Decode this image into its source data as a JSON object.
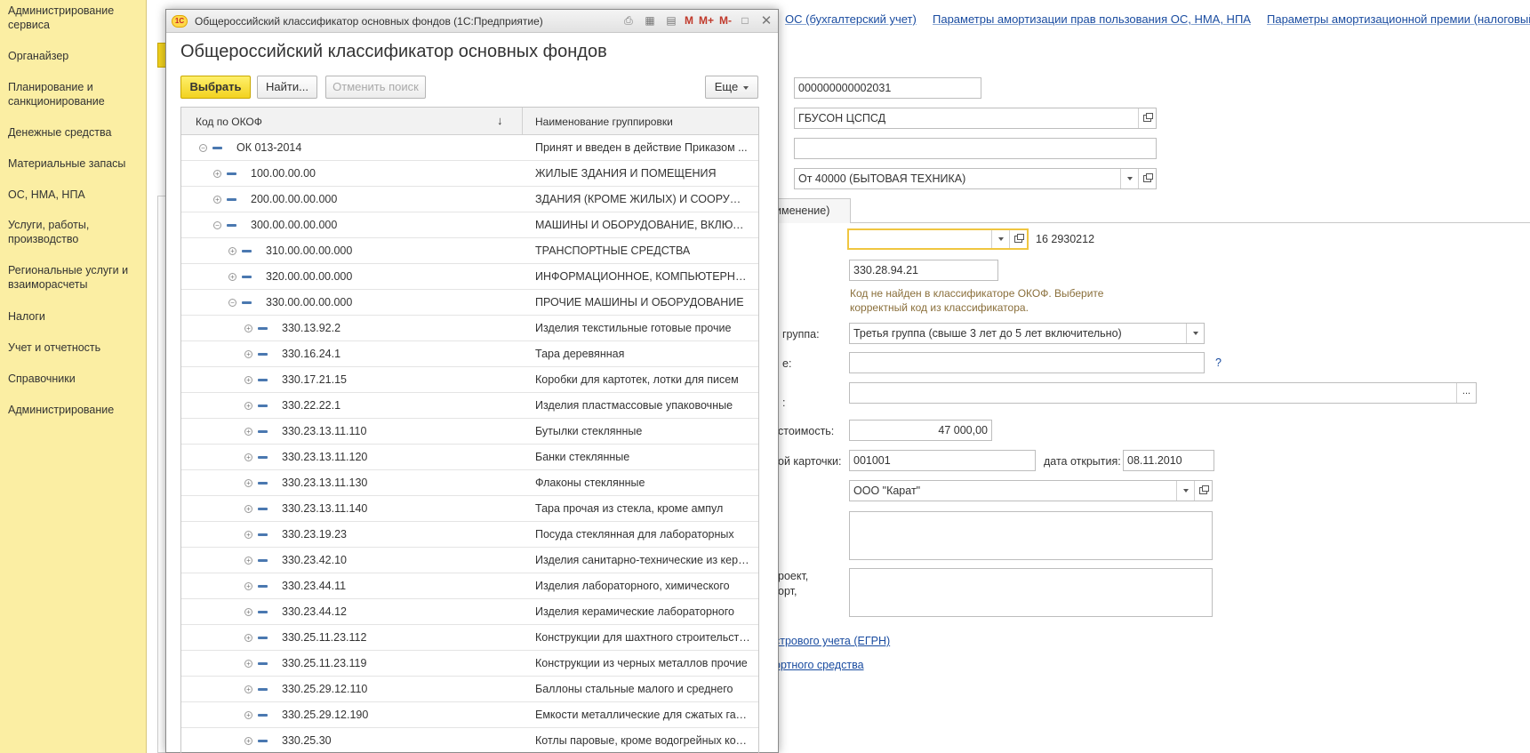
{
  "sidebar": {
    "items": [
      "Администрирование сервиса",
      "Органайзер",
      "Планирование и санкционирование",
      "Денежные средства",
      "Материальные запасы",
      "ОС, НМА, НПА",
      "Услуги, работы, производство",
      "Региональные услуги и взаиморасчеты",
      "Налоги",
      "Учет и отчетность",
      "Справочники",
      "Администрирование"
    ]
  },
  "background_form": {
    "nav_links": [
      "ОС (бухгалтерский учет)",
      "Параметры амортизации прав пользования ОС, НМА, НПА",
      "Параметры амортизационной премии (налоговый"
    ],
    "inventory_number": "000000000002031",
    "institution": "ГБУСОН ЦСПСД",
    "empty_field": "",
    "kbk_group": "От 40000  (БЫТОВАЯ ТЕХНИКА)",
    "tab_label": "именение)",
    "okof_code_value": "",
    "okof_hint_code": "16 2930212",
    "okof_code_field": "330.28.94.21",
    "okof_warning": "Код не найден в классификаторе ОКОФ. Выберите корректный код из классификатора.",
    "amort_group_label": "группа:",
    "amort_group_value": "Третья группа (свыше 3 лет до 5 лет включительно)",
    "label_e": "е:",
    "help_mark": "?",
    "label_colon": ":",
    "ellipsis": "...",
    "cost_label": "стоимость:",
    "cost_value": "47 000,00",
    "card_label": "ой карточки:",
    "card_number": "001001",
    "open_date_label": "дата открытия:",
    "open_date": "08.11.2010",
    "manufacturer": "ООО \"Карат\"",
    "project_label_1": "роект,",
    "project_label_2": "орт,",
    "link_egrn": "стрового учета (ЕГРН)",
    "link_transport": "ортного средства"
  },
  "modal": {
    "window_title": "Общероссийский классификатор основных фондов  (1С:Предприятие)",
    "logo_text": "1С",
    "title_icons": {
      "m": "M",
      "mplus": "M+",
      "mminus": "M-"
    },
    "heading": "Общероссийский классификатор основных фондов",
    "buttons": {
      "select": "Выбрать",
      "find": "Найти...",
      "cancel_search": "Отменить поиск",
      "more": "Еще"
    },
    "columns": {
      "code": "Код по ОКОФ",
      "sort_indicator": "↓",
      "name": "Наименование группировки"
    },
    "rows": [
      {
        "code": "ОК 013-2014",
        "name": "Принят и введен в действие Приказом ...",
        "level": 0,
        "state": "expanded"
      },
      {
        "code": "100.00.00.00",
        "name": "ЖИЛЫЕ ЗДАНИЯ И ПОМЕЩЕНИЯ",
        "level": 1,
        "state": "collapsed"
      },
      {
        "code": "200.00.00.00.000",
        "name": "ЗДАНИЯ (КРОМЕ ЖИЛЫХ) И СООРУЖЕНИЯ",
        "level": 1,
        "state": "collapsed"
      },
      {
        "code": "300.00.00.00.000",
        "name": "МАШИНЫ И ОБОРУДОВАНИЕ, ВКЛЮЧАЯ",
        "level": 1,
        "state": "expanded"
      },
      {
        "code": "310.00.00.00.000",
        "name": "ТРАНСПОРТНЫЕ СРЕДСТВА",
        "level": 2,
        "state": "collapsed"
      },
      {
        "code": "320.00.00.00.000",
        "name": "ИНФОРМАЦИОННОЕ, КОМПЬЮТЕРНОЕ",
        "level": 2,
        "state": "collapsed"
      },
      {
        "code": "330.00.00.00.000",
        "name": "ПРОЧИЕ МАШИНЫ И ОБОРУДОВАНИЕ",
        "level": 2,
        "state": "expanded"
      },
      {
        "code": "330.13.92.2",
        "name": "Изделия текстильные готовые прочие",
        "level": 3,
        "state": "collapsed"
      },
      {
        "code": "330.16.24.1",
        "name": "Тара деревянная",
        "level": 3,
        "state": "collapsed"
      },
      {
        "code": "330.17.21.15",
        "name": "Коробки для картотек, лотки для писем",
        "level": 3,
        "state": "collapsed"
      },
      {
        "code": "330.22.22.1",
        "name": "Изделия пластмассовые упаковочные",
        "level": 3,
        "state": "collapsed"
      },
      {
        "code": "330.23.13.11.110",
        "name": "Бутылки стеклянные",
        "level": 3,
        "state": "collapsed"
      },
      {
        "code": "330.23.13.11.120",
        "name": "Банки стеклянные",
        "level": 3,
        "state": "collapsed"
      },
      {
        "code": "330.23.13.11.130",
        "name": "Флаконы стеклянные",
        "level": 3,
        "state": "collapsed"
      },
      {
        "code": "330.23.13.11.140",
        "name": "Тара прочая из стекла, кроме ампул",
        "level": 3,
        "state": "collapsed"
      },
      {
        "code": "330.23.19.23",
        "name": "Посуда стеклянная для лабораторных",
        "level": 3,
        "state": "collapsed"
      },
      {
        "code": "330.23.42.10",
        "name": "Изделия санитарно-технические из керамики",
        "level": 3,
        "state": "collapsed"
      },
      {
        "code": "330.23.44.11",
        "name": "Изделия лабораторного, химического",
        "level": 3,
        "state": "collapsed"
      },
      {
        "code": "330.23.44.12",
        "name": "Изделия керамические лабораторного",
        "level": 3,
        "state": "collapsed"
      },
      {
        "code": "330.25.11.23.112",
        "name": "Конструкции для шахтного строительства",
        "level": 3,
        "state": "collapsed"
      },
      {
        "code": "330.25.11.23.119",
        "name": "Конструкции из черных металлов прочие",
        "level": 3,
        "state": "collapsed"
      },
      {
        "code": "330.25.29.12.110",
        "name": "Баллоны стальные малого и среднего",
        "level": 3,
        "state": "collapsed"
      },
      {
        "code": "330.25.29.12.190",
        "name": "Емкости металлические для сжатых газов",
        "level": 3,
        "state": "collapsed"
      },
      {
        "code": "330.25.30",
        "name": "Котлы паровые, кроме водогрейных котлов",
        "level": 3,
        "state": "collapsed"
      }
    ]
  }
}
